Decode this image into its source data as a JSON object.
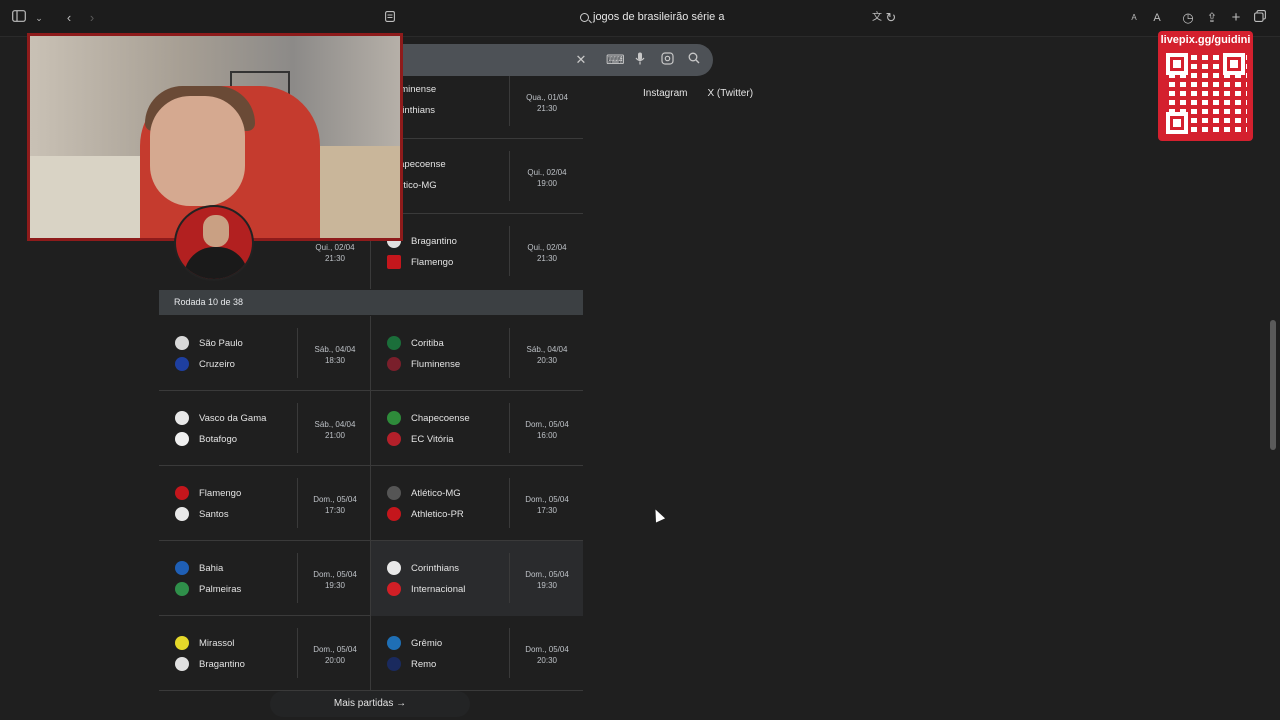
{
  "browser": {
    "url_text": "jogos de brasileirão série a",
    "icons": [
      "sidebar-icon",
      "chevron-down-icon",
      "back-icon",
      "forward-icon",
      "tabs-icon",
      "translate-icon",
      "reload-icon",
      "text-size-small-icon",
      "text-size-large-icon",
      "history-icon",
      "share-icon",
      "new-tab-icon",
      "tab-overview-icon"
    ],
    "text_small": "A",
    "text_large": "A"
  },
  "search": {
    "icons": [
      "close-icon",
      "keyboard-icon",
      "mic-icon",
      "lens-icon",
      "search-icon"
    ]
  },
  "overlay": {
    "qr_label": "livepix.gg/guidini"
  },
  "side_links": [
    "Instagram",
    "X (Twitter)"
  ],
  "colors": {
    "background": "#1f1f1f",
    "round_header": "#3c4043",
    "qr_red": "#d4202e",
    "webcam_border": "#8e1b1b"
  },
  "top_rows": [
    {
      "left": null,
      "right": {
        "home": "Fluminense",
        "away": "Corinthians",
        "date": "Qua., 01/04",
        "time": "21:30",
        "home_color": "#7a1f2b",
        "away_color": "#222222"
      }
    },
    {
      "left": null,
      "right": {
        "home": "Chapecoense",
        "away": "Atlético-MG",
        "date": "Qui., 02/04",
        "time": "19:00",
        "home_color": "#2e8b3a",
        "away_color": "#333333"
      }
    },
    {
      "left": {
        "date": "Qui., 02/04",
        "time": "21:30"
      },
      "right": {
        "home": "Bragantino",
        "away": "Flamengo",
        "date": "Qui., 02/04",
        "time": "21:30",
        "home_color": "#e0e0e0",
        "away_color": "#c4161c"
      }
    }
  ],
  "round_label": "Rodada 10 de 38",
  "round_rows": [
    {
      "left": {
        "home": "São Paulo",
        "away": "Cruzeiro",
        "date": "Sáb., 04/04",
        "time": "18:30",
        "home_color": "#d8d8d8",
        "away_color": "#1e3fa0"
      },
      "right": {
        "home": "Coritiba",
        "away": "Fluminense",
        "date": "Sáb., 04/04",
        "time": "20:30",
        "home_color": "#1b6e3a",
        "away_color": "#7a1f2b"
      }
    },
    {
      "left": {
        "home": "Vasco da Gama",
        "away": "Botafogo",
        "date": "Sáb., 04/04",
        "time": "21:00",
        "home_color": "#e8e8e8",
        "away_color": "#f0f0f0"
      },
      "right": {
        "home": "Chapecoense",
        "away": "EC Vitória",
        "date": "Dom., 05/04",
        "time": "16:00",
        "home_color": "#2e8b3a",
        "away_color": "#b3202a"
      }
    },
    {
      "left": {
        "home": "Flamengo",
        "away": "Santos",
        "date": "Dom., 05/04",
        "time": "17:30",
        "home_color": "#c4161c",
        "away_color": "#e8e8e8"
      },
      "right": {
        "home": "Atlético-MG",
        "away": "Athletico-PR",
        "date": "Dom., 05/04",
        "time": "17:30",
        "home_color": "#555555",
        "away_color": "#c4161c"
      }
    },
    {
      "left": {
        "home": "Bahia",
        "away": "Palmeiras",
        "date": "Dom., 05/04",
        "time": "19:30",
        "home_color": "#1f5fb5",
        "away_color": "#2f8f4a"
      },
      "right": {
        "home": "Corinthians",
        "away": "Internacional",
        "date": "Dom., 05/04",
        "time": "19:30",
        "home_color": "#e8e8e8",
        "away_color": "#d11f26"
      }
    },
    {
      "left": {
        "home": "Mirassol",
        "away": "Bragantino",
        "date": "Dom., 05/04",
        "time": "20:00",
        "home_color": "#e5d82a",
        "away_color": "#e0e0e0"
      },
      "right": {
        "home": "Grêmio",
        "away": "Remo",
        "date": "Dom., 05/04",
        "time": "20:30",
        "home_color": "#1f6fb5",
        "away_color": "#1a2a5e"
      }
    }
  ],
  "more_label": "Mais partidas"
}
